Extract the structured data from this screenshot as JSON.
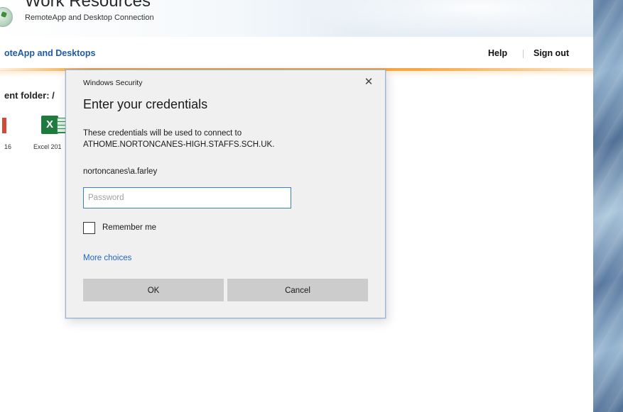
{
  "header": {
    "app_title": "Work Resources",
    "app_subtitle": "RemoteApp and Desktop Connection"
  },
  "nav": {
    "title": "oteApp and Desktops",
    "help": "Help",
    "sign_out": "Sign out"
  },
  "content": {
    "folder_label": "ent folder: /",
    "items": [
      {
        "label": "16",
        "icon": "office-app-icon"
      },
      {
        "label": "Excel 201",
        "icon": "excel-icon",
        "glyph": "X"
      }
    ]
  },
  "dialog": {
    "caption": "Windows Security",
    "close_glyph": "✕",
    "heading": "Enter your credentials",
    "description_line1": "These credentials will be used to connect to",
    "description_line2": "ATHOME.NORTONCANES-HIGH.STAFFS.SCH.UK.",
    "username": "nortoncanes\\a.farley",
    "password_value": "",
    "password_placeholder": "Password",
    "remember_label": "Remember me",
    "remember_checked": false,
    "more_choices": "More choices",
    "ok_label": "OK",
    "cancel_label": "Cancel"
  },
  "colors": {
    "accent_blue": "#1f5aa6",
    "link_blue": "#1f66c2",
    "header_orange": "#f2a33a",
    "input_focus": "#3b7fd1",
    "button_gray": "#cccccc",
    "dialog_bg": "#f0f0f0"
  }
}
